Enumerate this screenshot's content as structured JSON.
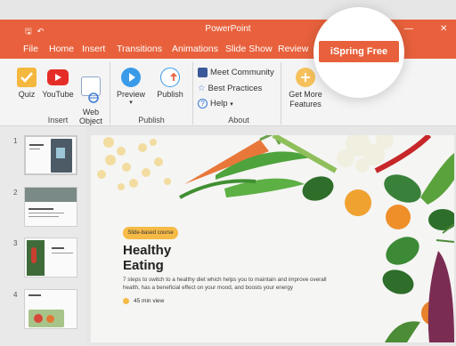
{
  "window": {
    "title": "PowerPoint",
    "minimize_glyph": "—",
    "close_glyph": "✕",
    "save_icon": "save-icon",
    "undo_icon": "undo-icon"
  },
  "menu": {
    "tabs": [
      "File",
      "Home",
      "Insert",
      "Transitions",
      "Animations",
      "Slide Show",
      "Review"
    ],
    "highlight_tab": "iSpring Free"
  },
  "ribbon": {
    "insert": {
      "label": "Insert",
      "buttons": [
        {
          "label": "Quiz",
          "icon": "quiz-icon"
        },
        {
          "label": "YouTube",
          "icon": "youtube-icon"
        },
        {
          "label": "Web\nObject",
          "icon": "web-object-icon"
        }
      ]
    },
    "publish": {
      "label": "Publish",
      "buttons": [
        {
          "label": "Preview",
          "icon": "preview-icon",
          "dropdown": "▾"
        },
        {
          "label": "Publish",
          "icon": "publish-icon"
        }
      ]
    },
    "about": {
      "label": "About",
      "items": [
        {
          "label": "Meet Community",
          "icon": "facebook-icon"
        },
        {
          "label": "Best Practices",
          "icon": "star-icon"
        },
        {
          "label": "Help",
          "icon": "help-icon",
          "dropdown": "▾"
        }
      ]
    },
    "features": {
      "label": "Get More Features",
      "icon": "plus-icon"
    }
  },
  "thumbnails": {
    "numbers": [
      "1",
      "2",
      "3",
      "4"
    ]
  },
  "slide": {
    "badge": "Slide-based course",
    "title_line1": "Healthy",
    "title_line2": "Eating",
    "description": "7 steps to switch to a healthy diet which helps you to maintain and improve overall health, has a beneficial effect on your mood, and boosts your energy",
    "duration": "45 min view"
  },
  "colors": {
    "accent": "#e8613c",
    "badge": "#f6bb46"
  }
}
